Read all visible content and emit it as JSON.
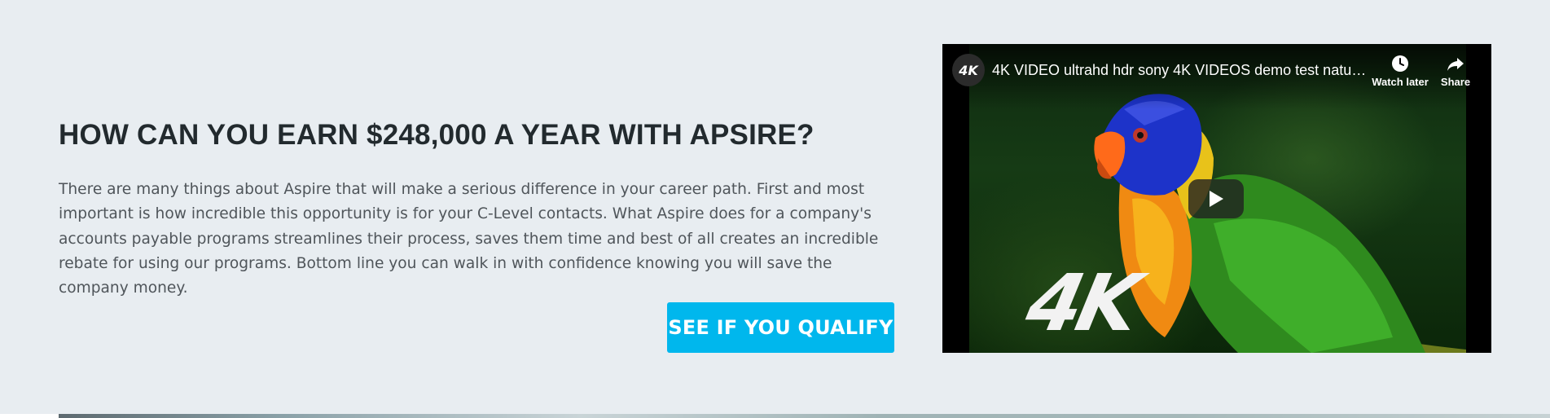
{
  "content": {
    "heading": "HOW CAN YOU EARN $248,000 A YEAR WITH APSIRE?",
    "paragraph": "There are many things about Aspire that will make a serious difference in your career path. First and most important is how incredible this opportunity is for your C-Level contacts. What Aspire does for a company's accounts payable programs streamlines their process, saves them time and best of all creates an incredible rebate for using our programs. Bottom line you can walk in with confidence knowing you will save the company money.",
    "cta_label": "SEE IF YOU QUALIFY"
  },
  "video": {
    "channel_logo": "4K",
    "title": "4K VIDEO ultrahd hdr sony 4K VIDEOS demo test natur...",
    "watch_later_label": "Watch later",
    "share_label": "Share",
    "watermark": "4K",
    "icons": [
      "clock-icon",
      "share-arrow-icon",
      "play-icon"
    ]
  },
  "colors": {
    "background": "#e8edf1",
    "cta": "#00b7ed",
    "heading": "#222a2e",
    "text": "#4f555a"
  }
}
